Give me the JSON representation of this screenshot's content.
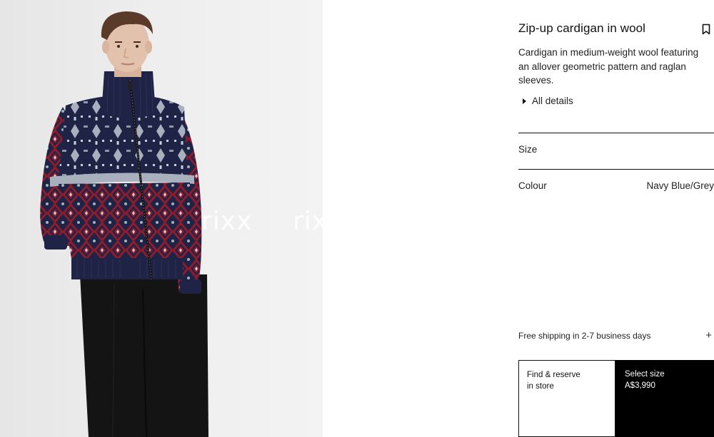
{
  "product": {
    "title": "Zip-up cardigan in wool",
    "description": "Cardigan in medium-weight wool featuring an allover geometric pattern and raglan sleeves.",
    "all_details_label": "All details",
    "size_label": "Size",
    "colour_label": "Colour",
    "colour_value": "Navy Blue/Grey"
  },
  "image": {
    "watermarks": [
      "rixx",
      "rix"
    ],
    "colors": {
      "navy": "#1f2346",
      "burgundy": "#8e1c2c",
      "grey": "#a7b0bc",
      "trousers": "#141414",
      "skin": "#e3c2ad",
      "hair": "#5a3b2a"
    }
  },
  "shipping": {
    "label": "Free shipping in 2-7 business days",
    "expand_icon": "plus-icon"
  },
  "actions": {
    "find_line1": "Find & reserve",
    "find_line2": "in store",
    "select_size": "Select size",
    "price": "A$3,990"
  }
}
